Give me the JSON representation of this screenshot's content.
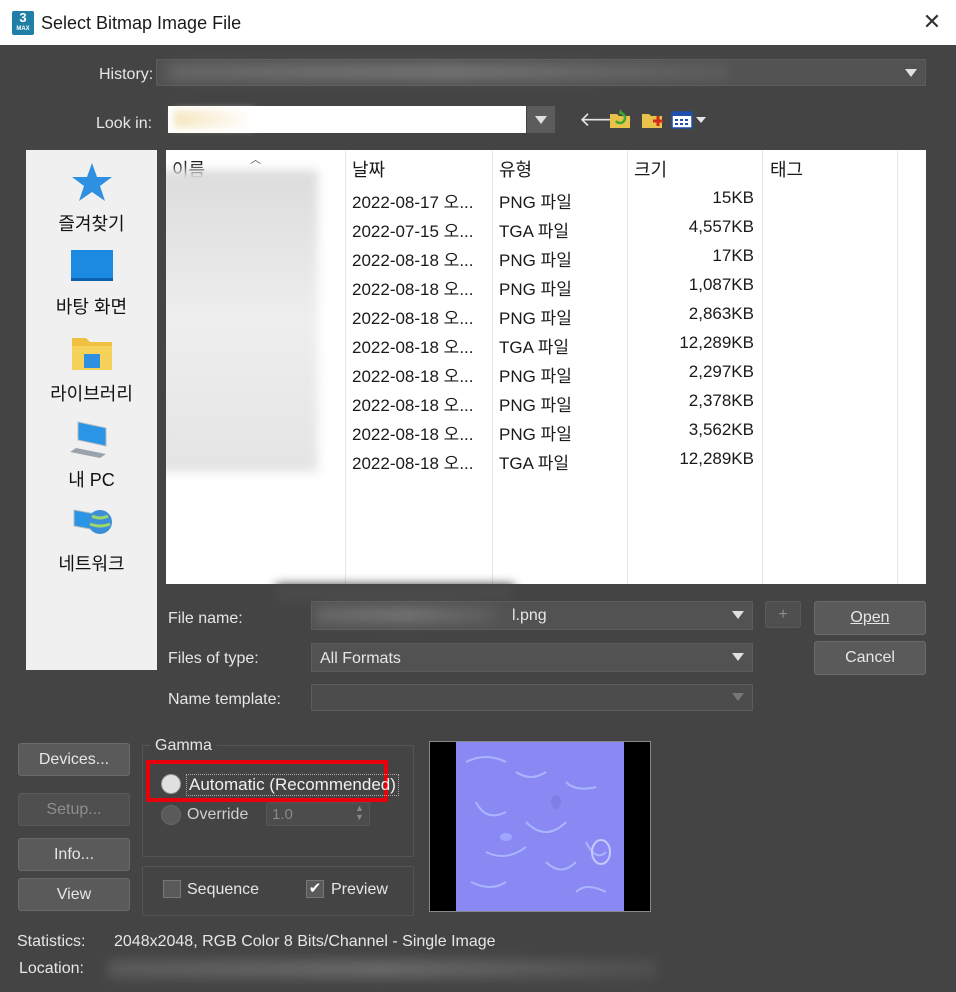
{
  "window": {
    "title": "Select Bitmap Image File",
    "app_badge": "3",
    "app_badge_sub": "MAX"
  },
  "history": {
    "label": "History:"
  },
  "look_in": {
    "label": "Look in:"
  },
  "places": [
    {
      "label": "즐겨찾기",
      "icon": "star-icon"
    },
    {
      "label": "바탕 화면",
      "icon": "desktop-icon"
    },
    {
      "label": "라이브러리",
      "icon": "library-folder-icon"
    },
    {
      "label": "내 PC",
      "icon": "computer-icon"
    },
    {
      "label": "네트워크",
      "icon": "network-icon"
    }
  ],
  "file_list": {
    "columns": [
      "이름",
      "날짜",
      "유형",
      "크기",
      "태그"
    ],
    "rows": [
      {
        "date": "2022-08-17 오...",
        "type": "PNG 파일",
        "size": "15KB"
      },
      {
        "date": "2022-07-15 오...",
        "type": "TGA 파일",
        "size": "4,557KB"
      },
      {
        "date": "2022-08-18 오...",
        "type": "PNG 파일",
        "size": "17KB"
      },
      {
        "date": "2022-08-18 오...",
        "type": "PNG 파일",
        "size": "1,087KB"
      },
      {
        "date": "2022-08-18 오...",
        "type": "PNG 파일",
        "size": "2,863KB"
      },
      {
        "date": "2022-08-18 오...",
        "type": "TGA 파일",
        "size": "12,289KB"
      },
      {
        "date": "2022-08-18 오...",
        "type": "PNG 파일",
        "size": "2,297KB"
      },
      {
        "date": "2022-08-18 오...",
        "type": "PNG 파일",
        "size": "2,378KB"
      },
      {
        "date": "2022-08-18 오...",
        "type": "PNG 파일",
        "size": "3,562KB"
      },
      {
        "date": "2022-08-18 오...",
        "type": "TGA 파일",
        "size": "12,289KB"
      }
    ]
  },
  "file_name": {
    "label": "File name:",
    "value_suffix": "l.png",
    "plus": "+"
  },
  "files_of_type": {
    "label": "Files of type:",
    "value": "All Formats"
  },
  "name_template": {
    "label": "Name template:"
  },
  "buttons": {
    "open": "Open",
    "cancel": "Cancel",
    "devices": "Devices...",
    "setup": "Setup...",
    "info": "Info...",
    "view": "View"
  },
  "gamma": {
    "title": "Gamma",
    "automatic": "Automatic (Recommended)",
    "override": "Override",
    "override_value": "1.0"
  },
  "options": {
    "sequence": "Sequence",
    "preview": "Preview",
    "preview_checked": true
  },
  "statistics": {
    "label": "Statistics:",
    "value": "2048x2048, RGB Color 8 Bits/Channel - Single Image"
  },
  "location": {
    "label": "Location:"
  },
  "colors": {
    "highlight": "#e8000a",
    "normal_map": "#8a88f2",
    "accent": "#1f7fa6"
  }
}
